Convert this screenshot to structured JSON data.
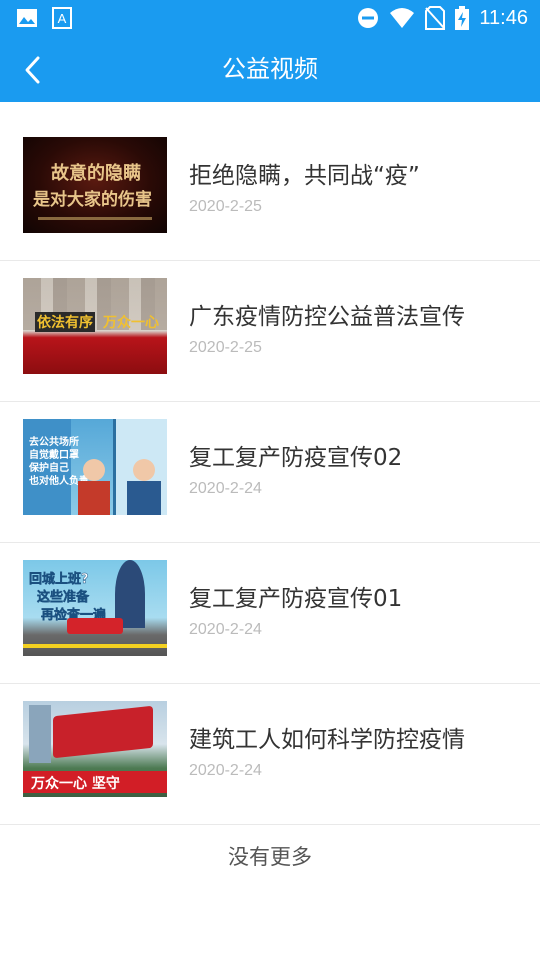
{
  "status_bar": {
    "time": "11:46"
  },
  "header": {
    "title": "公益视频"
  },
  "videos": [
    {
      "title": "拒绝隐瞒，共同战“疫”",
      "date": "2020-2-25",
      "thumb_text": [
        "故意的隐瞒",
        "是对大家的伤害"
      ]
    },
    {
      "title": "广东疫情防控公益普法宣传",
      "date": "2020-2-25",
      "thumb_text": [
        "依法有序",
        "万众一心"
      ]
    },
    {
      "title": "复工复产防疫宣传02",
      "date": "2020-2-24",
      "thumb_text": [
        "去公共场所",
        "自觉戴口罩",
        "保护自己",
        "也对他人负责"
      ]
    },
    {
      "title": "复工复产防疫宣传01",
      "date": "2020-2-24",
      "thumb_text": [
        "回城上班?",
        "这些准备",
        "再检查一遍"
      ]
    },
    {
      "title": "建筑工人如何科学防控疫情",
      "date": "2020-2-24",
      "thumb_text": [
        "万众一心 坚守"
      ]
    }
  ],
  "footer": {
    "text": "没有更多"
  },
  "colors": {
    "primary": "#1a9bf0",
    "title_text": "#333333",
    "date_text": "#bbbbbb"
  }
}
